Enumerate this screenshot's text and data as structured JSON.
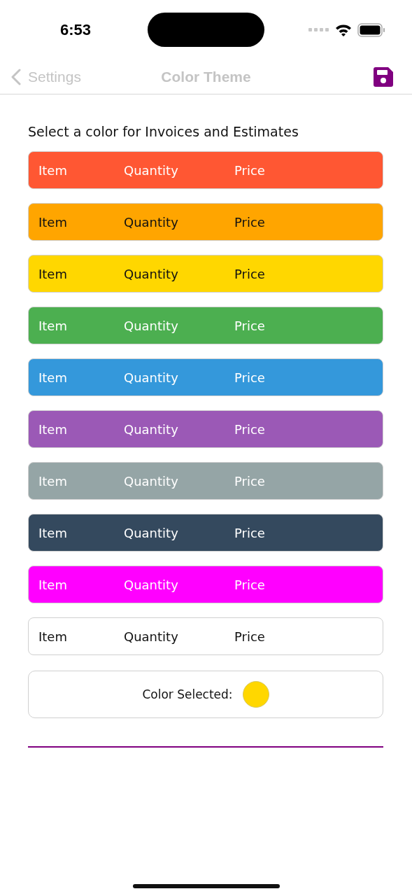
{
  "status_bar": {
    "time": "6:53"
  },
  "nav": {
    "back_label": "Settings",
    "title": "Color Theme"
  },
  "prompt": "Select a color for Invoices and Estimates",
  "themes": [
    {
      "color": "#ff5733",
      "dark_text": false,
      "columns": [
        "Item",
        "Quantity",
        "Price"
      ]
    },
    {
      "color": "#ffa500",
      "dark_text": true,
      "columns": [
        "Item",
        "Quantity",
        "Price"
      ]
    },
    {
      "color": "#ffd700",
      "dark_text": true,
      "columns": [
        "Item",
        "Quantity",
        "Price"
      ]
    },
    {
      "color": "#4caf50",
      "dark_text": false,
      "columns": [
        "Item",
        "Quantity",
        "Price"
      ]
    },
    {
      "color": "#3498db",
      "dark_text": false,
      "columns": [
        "Item",
        "Quantity",
        "Price"
      ]
    },
    {
      "color": "#9b59b6",
      "dark_text": false,
      "columns": [
        "Item",
        "Quantity",
        "Price"
      ]
    },
    {
      "color": "#95a5a6",
      "dark_text": false,
      "columns": [
        "Item",
        "Quantity",
        "Price"
      ]
    },
    {
      "color": "#34495e",
      "dark_text": false,
      "columns": [
        "Item",
        "Quantity",
        "Price"
      ]
    },
    {
      "color": "#ff00ff",
      "dark_text": false,
      "columns": [
        "Item",
        "Quantity",
        "Price"
      ]
    },
    {
      "color": "#ffffff",
      "dark_text": true,
      "columns": [
        "Item",
        "Quantity",
        "Price"
      ]
    }
  ],
  "color_selected": {
    "label": "Color Selected:",
    "color": "#ffd700"
  }
}
